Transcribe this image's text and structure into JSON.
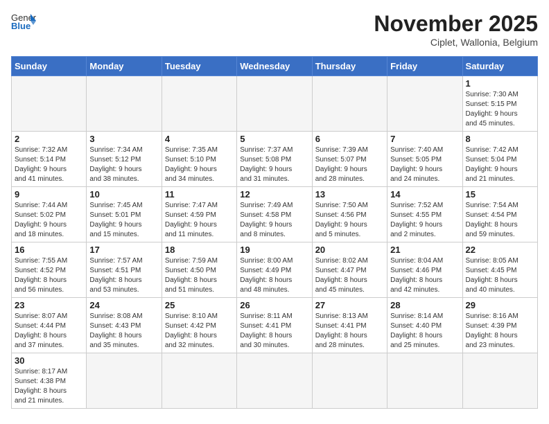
{
  "header": {
    "logo_general": "General",
    "logo_blue": "Blue",
    "month_year": "November 2025",
    "location": "Ciplet, Wallonia, Belgium"
  },
  "weekdays": [
    "Sunday",
    "Monday",
    "Tuesday",
    "Wednesday",
    "Thursday",
    "Friday",
    "Saturday"
  ],
  "days": [
    {
      "number": "",
      "info": ""
    },
    {
      "number": "",
      "info": ""
    },
    {
      "number": "",
      "info": ""
    },
    {
      "number": "",
      "info": ""
    },
    {
      "number": "",
      "info": ""
    },
    {
      "number": "",
      "info": ""
    },
    {
      "number": "1",
      "info": "Sunrise: 7:30 AM\nSunset: 5:15 PM\nDaylight: 9 hours\nand 45 minutes."
    },
    {
      "number": "2",
      "info": "Sunrise: 7:32 AM\nSunset: 5:14 PM\nDaylight: 9 hours\nand 41 minutes."
    },
    {
      "number": "3",
      "info": "Sunrise: 7:34 AM\nSunset: 5:12 PM\nDaylight: 9 hours\nand 38 minutes."
    },
    {
      "number": "4",
      "info": "Sunrise: 7:35 AM\nSunset: 5:10 PM\nDaylight: 9 hours\nand 34 minutes."
    },
    {
      "number": "5",
      "info": "Sunrise: 7:37 AM\nSunset: 5:08 PM\nDaylight: 9 hours\nand 31 minutes."
    },
    {
      "number": "6",
      "info": "Sunrise: 7:39 AM\nSunset: 5:07 PM\nDaylight: 9 hours\nand 28 minutes."
    },
    {
      "number": "7",
      "info": "Sunrise: 7:40 AM\nSunset: 5:05 PM\nDaylight: 9 hours\nand 24 minutes."
    },
    {
      "number": "8",
      "info": "Sunrise: 7:42 AM\nSunset: 5:04 PM\nDaylight: 9 hours\nand 21 minutes."
    },
    {
      "number": "9",
      "info": "Sunrise: 7:44 AM\nSunset: 5:02 PM\nDaylight: 9 hours\nand 18 minutes."
    },
    {
      "number": "10",
      "info": "Sunrise: 7:45 AM\nSunset: 5:01 PM\nDaylight: 9 hours\nand 15 minutes."
    },
    {
      "number": "11",
      "info": "Sunrise: 7:47 AM\nSunset: 4:59 PM\nDaylight: 9 hours\nand 11 minutes."
    },
    {
      "number": "12",
      "info": "Sunrise: 7:49 AM\nSunset: 4:58 PM\nDaylight: 9 hours\nand 8 minutes."
    },
    {
      "number": "13",
      "info": "Sunrise: 7:50 AM\nSunset: 4:56 PM\nDaylight: 9 hours\nand 5 minutes."
    },
    {
      "number": "14",
      "info": "Sunrise: 7:52 AM\nSunset: 4:55 PM\nDaylight: 9 hours\nand 2 minutes."
    },
    {
      "number": "15",
      "info": "Sunrise: 7:54 AM\nSunset: 4:54 PM\nDaylight: 8 hours\nand 59 minutes."
    },
    {
      "number": "16",
      "info": "Sunrise: 7:55 AM\nSunset: 4:52 PM\nDaylight: 8 hours\nand 56 minutes."
    },
    {
      "number": "17",
      "info": "Sunrise: 7:57 AM\nSunset: 4:51 PM\nDaylight: 8 hours\nand 53 minutes."
    },
    {
      "number": "18",
      "info": "Sunrise: 7:59 AM\nSunset: 4:50 PM\nDaylight: 8 hours\nand 51 minutes."
    },
    {
      "number": "19",
      "info": "Sunrise: 8:00 AM\nSunset: 4:49 PM\nDaylight: 8 hours\nand 48 minutes."
    },
    {
      "number": "20",
      "info": "Sunrise: 8:02 AM\nSunset: 4:47 PM\nDaylight: 8 hours\nand 45 minutes."
    },
    {
      "number": "21",
      "info": "Sunrise: 8:04 AM\nSunset: 4:46 PM\nDaylight: 8 hours\nand 42 minutes."
    },
    {
      "number": "22",
      "info": "Sunrise: 8:05 AM\nSunset: 4:45 PM\nDaylight: 8 hours\nand 40 minutes."
    },
    {
      "number": "23",
      "info": "Sunrise: 8:07 AM\nSunset: 4:44 PM\nDaylight: 8 hours\nand 37 minutes."
    },
    {
      "number": "24",
      "info": "Sunrise: 8:08 AM\nSunset: 4:43 PM\nDaylight: 8 hours\nand 35 minutes."
    },
    {
      "number": "25",
      "info": "Sunrise: 8:10 AM\nSunset: 4:42 PM\nDaylight: 8 hours\nand 32 minutes."
    },
    {
      "number": "26",
      "info": "Sunrise: 8:11 AM\nSunset: 4:41 PM\nDaylight: 8 hours\nand 30 minutes."
    },
    {
      "number": "27",
      "info": "Sunrise: 8:13 AM\nSunset: 4:41 PM\nDaylight: 8 hours\nand 28 minutes."
    },
    {
      "number": "28",
      "info": "Sunrise: 8:14 AM\nSunset: 4:40 PM\nDaylight: 8 hours\nand 25 minutes."
    },
    {
      "number": "29",
      "info": "Sunrise: 8:16 AM\nSunset: 4:39 PM\nDaylight: 8 hours\nand 23 minutes."
    },
    {
      "number": "30",
      "info": "Sunrise: 8:17 AM\nSunset: 4:38 PM\nDaylight: 8 hours\nand 21 minutes."
    },
    {
      "number": "",
      "info": ""
    },
    {
      "number": "",
      "info": ""
    },
    {
      "number": "",
      "info": ""
    },
    {
      "number": "",
      "info": ""
    },
    {
      "number": "",
      "info": ""
    },
    {
      "number": "",
      "info": ""
    }
  ]
}
